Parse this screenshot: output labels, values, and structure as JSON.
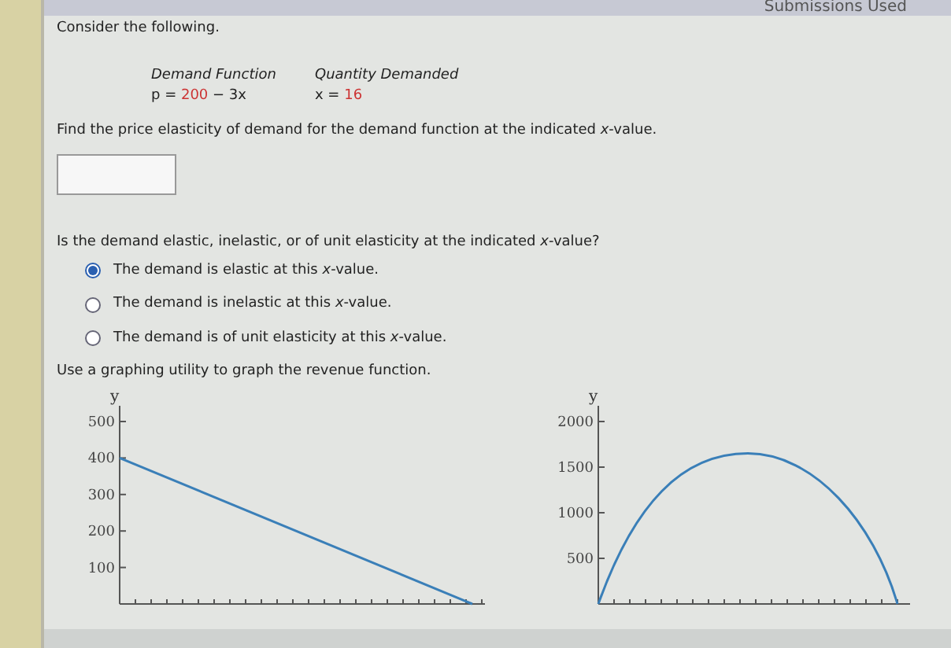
{
  "header": {
    "submissions": "Submissions Used"
  },
  "intro": "Consider the following.",
  "table": {
    "columns": [
      "Demand Function",
      "Quantity Demanded"
    ],
    "values": [
      {
        "parts": [
          {
            "t": "p = ",
            "red": false
          },
          {
            "t": "200",
            "red": true
          },
          {
            "t": " − 3x",
            "red": false
          }
        ]
      },
      {
        "parts": [
          {
            "t": "x = ",
            "red": false
          },
          {
            "t": "16",
            "red": true
          }
        ]
      }
    ]
  },
  "question1": "Find the price elasticity of demand for the demand function at the indicated *x*-value.",
  "question2": "Is the demand elastic, inelastic, or of unit elasticity at the indicated *x*-value?",
  "options": [
    {
      "label": "The demand is elastic at this *x*-value.",
      "selected": true
    },
    {
      "label": "The demand is inelastic at this *x*-value.",
      "selected": false
    },
    {
      "label": "The demand is of unit elasticity at this *x*-value.",
      "selected": false
    }
  ],
  "instruction": "Use a graphing utility to graph the revenue function.",
  "charts": [
    {
      "kind": "straight",
      "ylabel": "y",
      "yticks": [
        "500",
        "400",
        "300",
        "200",
        "100"
      ]
    },
    {
      "kind": "arch",
      "ylabel": "y",
      "yticks": [
        "2000",
        "1500",
        "1000",
        "500"
      ]
    }
  ]
}
